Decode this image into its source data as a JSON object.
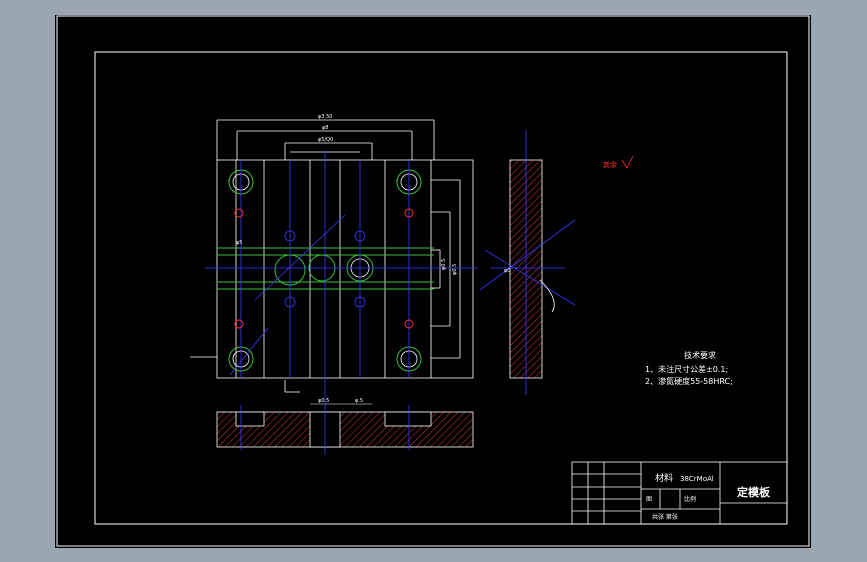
{
  "drawing": {
    "title_block": {
      "material_label": "材料",
      "material_value": "38CrMoAl",
      "part_name": "定模板",
      "sheet_label": "共张 第张",
      "ratio_label": "比例",
      "scale_label": "图"
    },
    "technical_requirements": {
      "heading": "技术要求",
      "items": [
        "1、未注尺寸公差±0.1;",
        "2、渗氮硬度55-58HRC;"
      ]
    },
    "roughness_note": "其余",
    "dimensions": {
      "overall_width": "φ3.50",
      "inner_width_1": "φ8",
      "inner_width_2": "φ5/Q0",
      "left_slot": "φ5",
      "vertical_1": "φ0.5",
      "vertical_2": "φ0.5",
      "section_dim_1": "φ0.5",
      "section_dim_2": "φ.5",
      "right_height": "φ0"
    },
    "colors": {
      "background": "#000000",
      "outer_bg": "#9aa6b2",
      "line_white": "#ffffff",
      "line_blue": "#3a3aff",
      "line_green": "#39c339",
      "line_red": "#ff2a2a",
      "hatch": "#d23a3a"
    }
  }
}
